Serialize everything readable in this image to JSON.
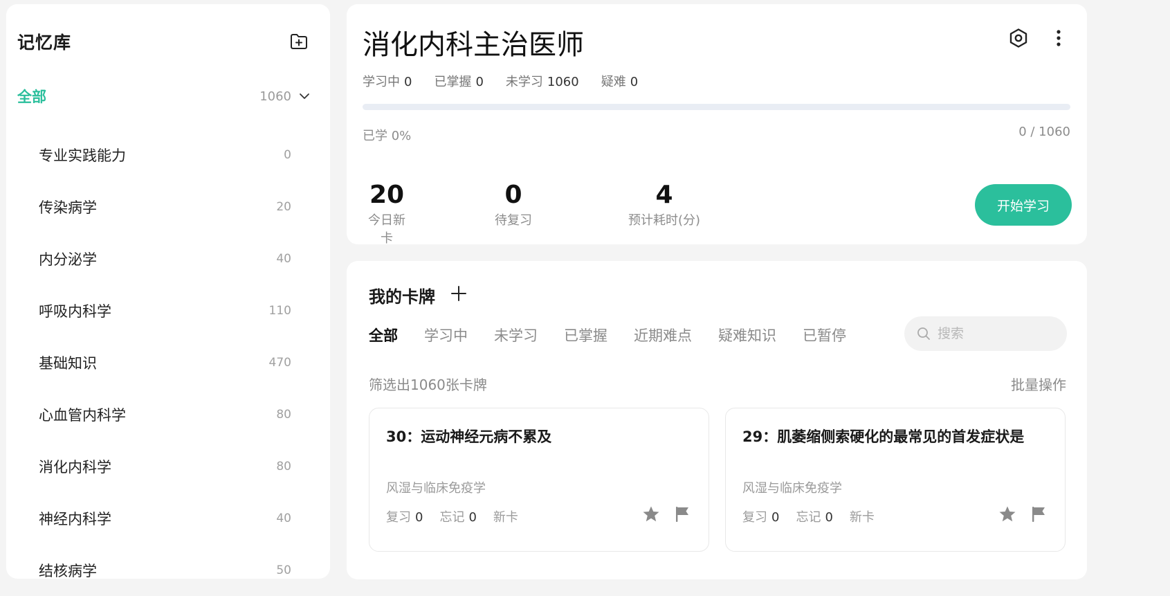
{
  "sidebar": {
    "title": "记忆库",
    "all_label": "全部",
    "all_count": "1060",
    "items": [
      {
        "label": "专业实践能力",
        "count": "0"
      },
      {
        "label": "传染病学",
        "count": "20"
      },
      {
        "label": "内分泌学",
        "count": "40"
      },
      {
        "label": "呼吸内科学",
        "count": "110"
      },
      {
        "label": "基础知识",
        "count": "470"
      },
      {
        "label": "心血管内科学",
        "count": "80"
      },
      {
        "label": "消化内科学",
        "count": "80"
      },
      {
        "label": "神经内科学",
        "count": "40"
      },
      {
        "label": "结核病学",
        "count": "50"
      }
    ]
  },
  "deck": {
    "title": "消化内科主治医师",
    "stats": [
      {
        "label": "学习中",
        "value": "0"
      },
      {
        "label": "已掌握",
        "value": "0"
      },
      {
        "label": "未学习",
        "value": "1060"
      },
      {
        "label": "疑难",
        "value": "0"
      }
    ],
    "progress_percent": 0,
    "progress_label": "已学 0%",
    "progress_count": "0 / 1060",
    "big_stats": [
      {
        "value": "20",
        "label": "今日新卡"
      },
      {
        "value": "0",
        "label": "待复习"
      },
      {
        "value": "4",
        "label": "预计耗时(分)"
      }
    ],
    "start_button": "开始学习"
  },
  "cards_panel": {
    "title": "我的卡牌",
    "tabs": [
      "全部",
      "学习中",
      "未学习",
      "已掌握",
      "近期难点",
      "疑难知识",
      "已暂停"
    ],
    "active_tab": "全部",
    "search_placeholder": "搜索",
    "filter_text": "筛选出1060张卡牌",
    "batch_label": "批量操作",
    "cards": [
      {
        "title": "30：运动神经元病不累及",
        "subject": "风湿与临床免疫学",
        "review_label": "复习",
        "review_value": "0",
        "forget_label": "忘记",
        "forget_value": "0",
        "status": "新卡"
      },
      {
        "title": "29：肌萎缩侧索硬化的最常见的首发症状是",
        "subject": "风湿与临床免疫学",
        "review_label": "复习",
        "review_value": "0",
        "forget_label": "忘记",
        "forget_value": "0",
        "status": "新卡"
      }
    ]
  },
  "colors": {
    "accent": "#2bbf9c",
    "background": "#f4f4f4",
    "card": "#ffffff",
    "muted_text": "#8c8c8c",
    "progress_track": "#e9edf4"
  },
  "icons": {
    "add_folder": "folder-plus-icon",
    "expand": "chevron-down-icon",
    "settings": "hexagon-gear-icon",
    "more": "vertical-dots-icon",
    "search": "search-icon",
    "star": "star-icon",
    "flag": "flag-icon"
  }
}
